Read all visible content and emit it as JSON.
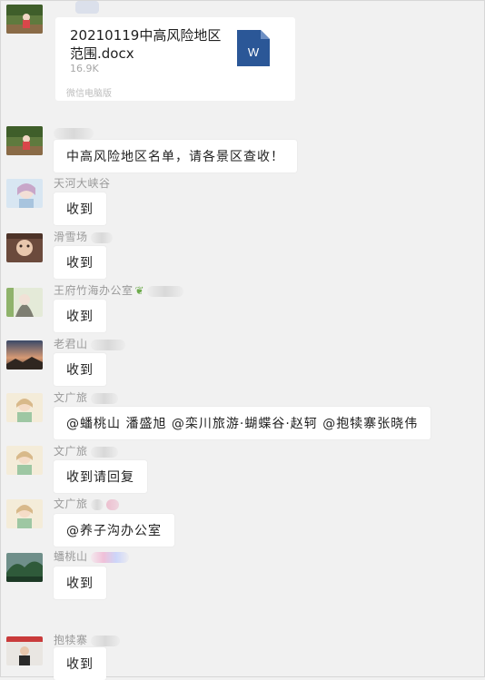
{
  "file_message": {
    "file_name": "20210119中高风险地区范围.docx",
    "file_size": "16.9K",
    "source": "微信电脑版"
  },
  "messages": [
    {
      "sender": "",
      "text": "中高风险地区名单，请各景区查收！"
    },
    {
      "sender": "天河大峡谷",
      "text": "收到"
    },
    {
      "sender": "滑雪场",
      "text": "收到"
    },
    {
      "sender": "王府竹海办公室",
      "text": "收到"
    },
    {
      "sender": "老君山",
      "text": "收到"
    },
    {
      "sender": "文广旅",
      "text": "@蟠桃山 潘盛旭 @栾川旅游·蝴蝶谷·赵轲 @抱犊寨张晓伟"
    },
    {
      "sender": "文广旅",
      "text": "收到请回复"
    },
    {
      "sender": "文广旅",
      "text": "@养子沟办公室"
    },
    {
      "sender": "蟠桃山",
      "text": "收到"
    },
    {
      "sender": "抱犊寨",
      "text": "收到"
    }
  ]
}
